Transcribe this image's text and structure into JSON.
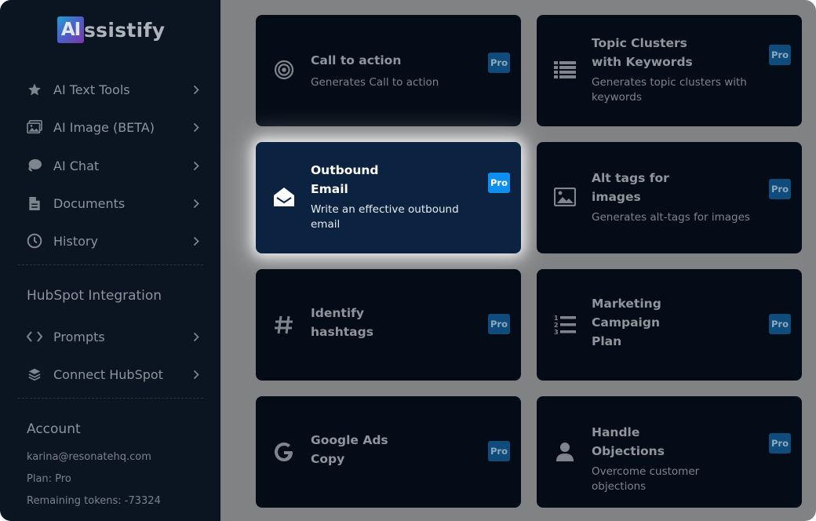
{
  "app": {
    "logo_badge": "AI",
    "logo_text": "ssistify"
  },
  "sidebar": {
    "items": [
      {
        "label": "AI Text Tools",
        "icon": "star-icon"
      },
      {
        "label": "AI Image (BETA)",
        "icon": "image-icon"
      },
      {
        "label": "AI Chat",
        "icon": "chat-icon"
      },
      {
        "label": "Documents",
        "icon": "document-icon"
      },
      {
        "label": "History",
        "icon": "clock-icon"
      }
    ],
    "hubspot": {
      "title": "HubSpot Integration",
      "items": [
        {
          "label": "Prompts",
          "icon": "code-icon"
        },
        {
          "label": "Connect HubSpot",
          "icon": "layers-icon"
        }
      ]
    },
    "account": {
      "title": "Account",
      "email": "karina@resonatehq.com",
      "plan": "Plan: Pro",
      "tokens": "Remaining tokens: -73324"
    }
  },
  "cards": [
    {
      "title_lines": [
        "Call to action"
      ],
      "desc_lines": [
        "Generates Call to action"
      ],
      "badge": "Pro",
      "icon": "target-icon"
    },
    {
      "title_lines": [
        "Topic Clusters",
        "with Keywords"
      ],
      "desc_lines": [
        "Generates topic clusters with",
        "keywords"
      ],
      "badge": "Pro",
      "icon": "list-icon"
    },
    {
      "title_lines": [
        "Outbound",
        "Email"
      ],
      "desc_lines": [
        "Write an effective outbound",
        "email"
      ],
      "badge": "Pro",
      "icon": "envelope-open-icon"
    },
    {
      "title_lines": [
        "Alt tags for",
        "images"
      ],
      "desc_lines": [
        "Generates alt-tags for images"
      ],
      "badge": "Pro",
      "icon": "image-icon"
    },
    {
      "title_lines": [
        "Identify",
        "hashtags"
      ],
      "desc_lines": [],
      "badge": "Pro",
      "icon": "hashtag-icon"
    },
    {
      "title_lines": [
        "Marketing",
        "Campaign",
        "Plan"
      ],
      "desc_lines": [],
      "badge": "Pro",
      "icon": "numbered-list-icon"
    },
    {
      "title_lines": [
        "Google Ads",
        "Copy"
      ],
      "desc_lines": [],
      "badge": "Pro",
      "icon": "google-icon"
    },
    {
      "title_lines": [
        "Handle",
        "Objections"
      ],
      "desc_lines": [
        "Overcome customer objections"
      ],
      "badge": "Pro",
      "icon": "user-icon"
    }
  ],
  "colors": {
    "sidebar_bg": "#0b1522",
    "card_bg": "#040d17",
    "active_card_bg": "#0b2240",
    "pro_active": "#0d8ff0"
  }
}
